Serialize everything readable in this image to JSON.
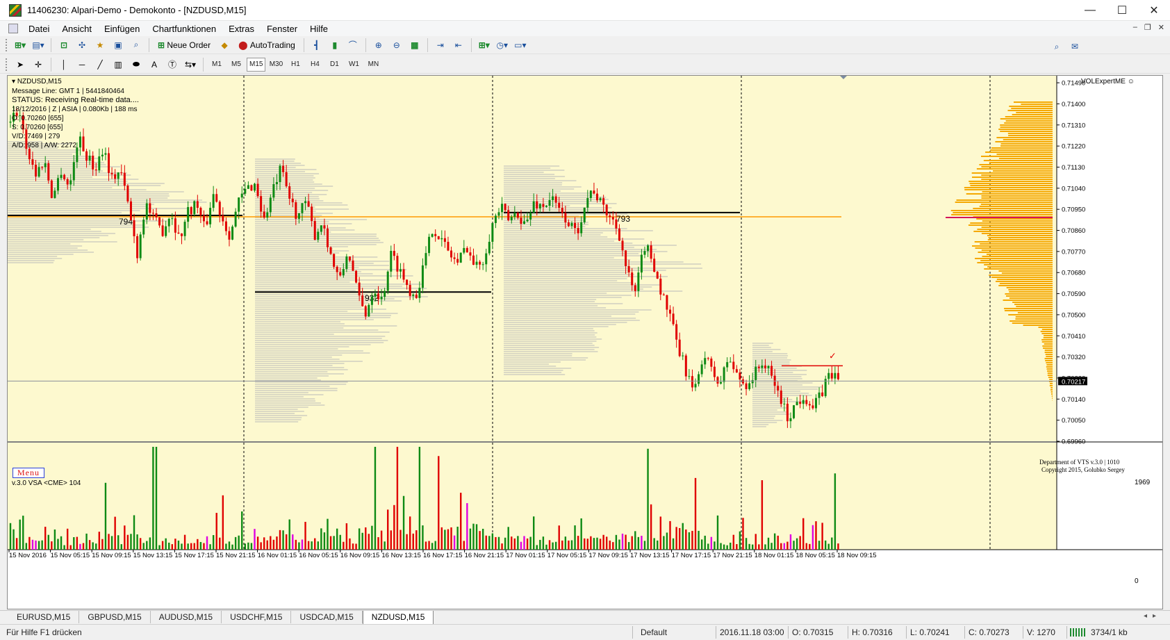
{
  "window": {
    "title": "11406230: Alpari-Demo - Demokonto - [NZDUSD,M15]",
    "controls": {
      "minimize": "—",
      "maximize": "☐",
      "close": "✕"
    },
    "mdi": {
      "minimize": "–",
      "restore": "❐",
      "close": "✕"
    }
  },
  "menu": [
    "Datei",
    "Ansicht",
    "Einfügen",
    "Chartfunktionen",
    "Extras",
    "Fenster",
    "Hilfe"
  ],
  "toolbar": {
    "new_order_label": "Neue Order",
    "autotrading_label": "AutoTrading"
  },
  "timeframes": [
    "M1",
    "M5",
    "M15",
    "M30",
    "H1",
    "H4",
    "D1",
    "W1",
    "MN"
  ],
  "active_timeframe": "M15",
  "chart": {
    "symbol_label": "NZDUSD,M15",
    "info_lines": [
      "Message Line: GMT 1 | 5441840464",
      "STATUS:  Receiving Real-time data....",
      "18/12/2016 | Z | ASIA | 0.080Kb | 188 ms",
      "O: 0.70260  [655]",
      "S: 0.70260  [655]",
      "V/D: 7469 | 279",
      "A/D: 958 | A/W: 2272"
    ],
    "expert_label": "VOLExpertME ☺",
    "credit_line1": "Department of VTS  v.3.0 | 1010",
    "credit_line2": "Copyright 2015, Golubko Sergey",
    "menu_button": "Menu",
    "indicator_label": "v.3.0 VSA <CME> 104",
    "indicator_max_label": "1969",
    "indicator_min_label": "0",
    "current_price_label": "0.70217",
    "level_labels": {
      "first": "794",
      "second": "932",
      "third": "793"
    },
    "colors": {
      "background": "#fdf9cf",
      "bull": "#0e8a14",
      "bear": "#e00000",
      "orange_line": "#ff9900",
      "profile_bar": "#f5a800"
    }
  },
  "chart_data": {
    "type": "candlestick",
    "symbol": "NZDUSD",
    "timeframe": "M15",
    "y_ticks": [
      "0.71490",
      "0.71400",
      "0.71310",
      "0.71220",
      "0.71130",
      "0.71040",
      "0.70950",
      "0.70860",
      "0.70770",
      "0.70680",
      "0.70590",
      "0.70500",
      "0.70410",
      "0.70320",
      "0.70230",
      "0.70140",
      "0.70050",
      "0.69960"
    ],
    "ylim": [
      0.6996,
      0.7152
    ],
    "x_ticks": [
      "15 Nov 2016",
      "15 Nov 05:15",
      "15 Nov 09:15",
      "15 Nov 13:15",
      "15 Nov 17:15",
      "15 Nov 21:15",
      "16 Nov 01:15",
      "16 Nov 05:15",
      "16 Nov 09:15",
      "16 Nov 13:15",
      "16 Nov 17:15",
      "16 Nov 21:15",
      "17 Nov 01:15",
      "17 Nov 05:15",
      "17 Nov 09:15",
      "17 Nov 13:15",
      "17 Nov 17:15",
      "17 Nov 21:15",
      "18 Nov 01:15",
      "18 Nov 05:15",
      "18 Nov 09:15"
    ],
    "current_price": 0.70217,
    "orange_level": 0.70918,
    "poc_levels": [
      {
        "label": "794",
        "price": 0.70924
      },
      {
        "label": "932",
        "price": 0.70597
      },
      {
        "label": "793",
        "price": 0.70936
      }
    ],
    "close_path": [
      0.7132,
      0.7138,
      0.712,
      0.711,
      0.7116,
      0.71,
      0.7112,
      0.7104,
      0.7126,
      0.7118,
      0.7112,
      0.7122,
      0.7108,
      0.7112,
      0.7096,
      0.7076,
      0.7098,
      0.709,
      0.7086,
      0.7094,
      0.7082,
      0.7094,
      0.7098,
      0.7086,
      0.7102,
      0.7092,
      0.7084,
      0.7098,
      0.7104,
      0.7106,
      0.709,
      0.7102,
      0.7112,
      0.71,
      0.7092,
      0.7098,
      0.7084,
      0.709,
      0.7074,
      0.7064,
      0.7078,
      0.706,
      0.705,
      0.7062,
      0.7056,
      0.7076,
      0.707,
      0.7062,
      0.7058,
      0.7072,
      0.7088,
      0.7082,
      0.7076,
      0.7072,
      0.708,
      0.707,
      0.7074,
      0.7088,
      0.7096,
      0.709,
      0.7094,
      0.7088,
      0.7098,
      0.7096,
      0.71,
      0.7094,
      0.709,
      0.7084,
      0.7098,
      0.7104,
      0.7096,
      0.7092,
      0.7086,
      0.7068,
      0.7058,
      0.708,
      0.7074,
      0.706,
      0.705,
      0.7036,
      0.7026,
      0.7016,
      0.7034,
      0.7026,
      0.702,
      0.7032,
      0.7024,
      0.702,
      0.7024,
      0.703,
      0.7024,
      0.7016,
      0.7006,
      0.7012,
      0.7016,
      0.701,
      0.7016,
      0.7026,
      0.7022
    ],
    "volume_ylim": [
      0,
      1969
    ],
    "volume_peaks": [
      1969,
      1280,
      1040,
      1500,
      1560,
      1450,
      1120,
      1380,
      980,
      1460,
      1330
    ],
    "session_labels": [],
    "title": "",
    "xlabel": "",
    "ylabel": ""
  },
  "tabs": [
    "EURUSD,M15",
    "GBPUSD,M15",
    "AUDUSD,M15",
    "USDCHF,M15",
    "USDCAD,M15",
    "NZDUSD,M15"
  ],
  "active_tab": "NZDUSD,M15",
  "status": {
    "help": "Für Hilfe F1 drücken",
    "profile": "Default",
    "datetime": "2016.11.18 03:00",
    "open": "O: 0.70315",
    "high": "H: 0.70316",
    "low": "L: 0.70241",
    "close": "C: 0.70273",
    "volume": "V: 1270",
    "connection": "3734/1 kb"
  }
}
